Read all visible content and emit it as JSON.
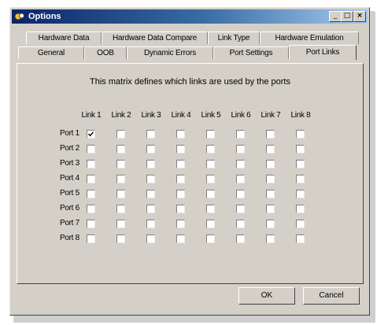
{
  "window": {
    "title": "Options",
    "minimize_glyph": "_",
    "maximize_glyph": "□",
    "close_glyph": "×"
  },
  "tabs_row1": [
    {
      "label": "Hardware Data"
    },
    {
      "label": "Hardware Data Compare"
    },
    {
      "label": "Link Type"
    },
    {
      "label": "Hardware Emulation"
    }
  ],
  "tabs_row2": [
    {
      "label": "General"
    },
    {
      "label": "OOB"
    },
    {
      "label": "Dynamic Errors"
    },
    {
      "label": "Port Settings"
    },
    {
      "label": "Port Links",
      "active": true
    }
  ],
  "panel": {
    "description": "This matrix defines which links are used by the ports"
  },
  "matrix": {
    "columns": [
      "Link 1",
      "Link 2",
      "Link 3",
      "Link 4",
      "Link 5",
      "Link 6",
      "Link 7",
      "Link 8"
    ],
    "rows": [
      "Port 1",
      "Port 2",
      "Port 3",
      "Port 4",
      "Port 5",
      "Port 6",
      "Port 7",
      "Port 8"
    ],
    "checked": [
      [
        true,
        false,
        false,
        false,
        false,
        false,
        false,
        false
      ],
      [
        false,
        false,
        false,
        false,
        false,
        false,
        false,
        false
      ],
      [
        false,
        false,
        false,
        false,
        false,
        false,
        false,
        false
      ],
      [
        false,
        false,
        false,
        false,
        false,
        false,
        false,
        false
      ],
      [
        false,
        false,
        false,
        false,
        false,
        false,
        false,
        false
      ],
      [
        false,
        false,
        false,
        false,
        false,
        false,
        false,
        false
      ],
      [
        false,
        false,
        false,
        false,
        false,
        false,
        false,
        false
      ],
      [
        false,
        false,
        false,
        false,
        false,
        false,
        false,
        false
      ]
    ]
  },
  "buttons": {
    "ok": "OK",
    "cancel": "Cancel"
  }
}
